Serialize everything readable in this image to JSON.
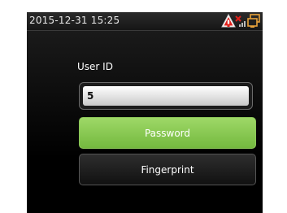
{
  "status_bar": {
    "datetime": "2015-12-31 15:25",
    "icons": [
      "alarm-warning-icon",
      "no-signal-icon",
      "network-icon"
    ]
  },
  "form": {
    "user_id_label": "User ID",
    "user_id_value": "5",
    "password_button": "Password",
    "fingerprint_button": "Fingerprint"
  },
  "colors": {
    "accent_green": "#8cc659",
    "warning_red": "#e0201a",
    "network_orange": "#e8a23a"
  }
}
